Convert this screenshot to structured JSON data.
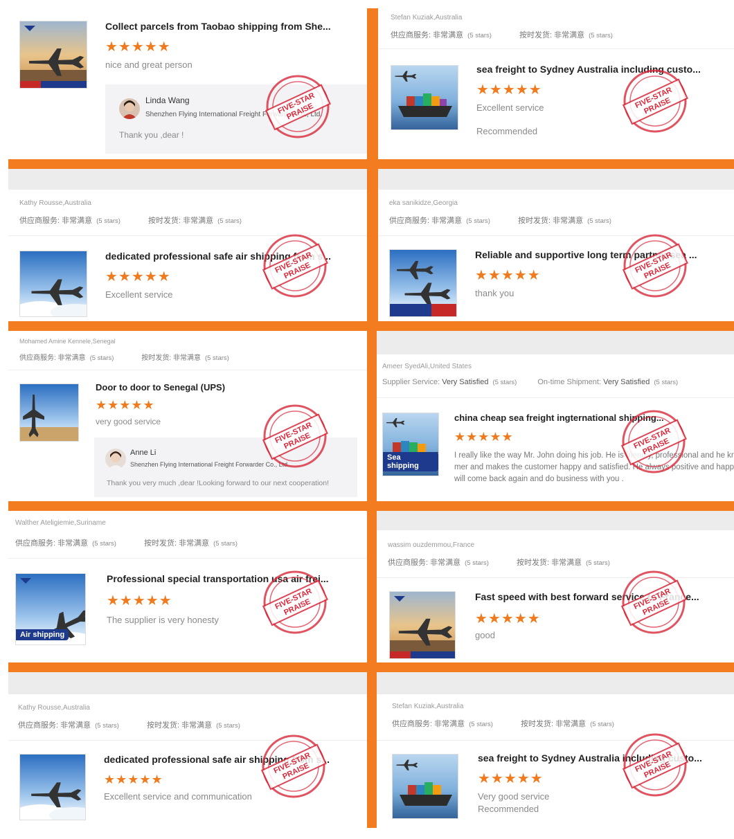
{
  "stamp_text": {
    "line1": "FIVE-STAR",
    "line2": "PRAISE"
  },
  "colors": {
    "accent": "#f37b20",
    "stars": "#f07a1e",
    "stamp": "#d8283a"
  },
  "labels": {
    "supplier_cn": "供应商服务: 非常满意",
    "ontime_cn": "按时发货: 非常满意",
    "stars": "(5 stars)"
  },
  "cards": [
    {
      "title": "Collect parcels from Taobao shipping from She...",
      "stars": "★★★★★",
      "comment": "nice and great person",
      "reply": {
        "name": "Linda Wang",
        "company": "Shenzhen Flying International Freight Forwarder Co., Ltd.",
        "text": "Thank you ,dear !"
      }
    },
    {
      "reviewer": "Stefan Kuziak,Australia",
      "title": "sea freight to Sydney Australia including custo...",
      "stars": "★★★★★",
      "comment": "Excellent service",
      "comment2": "Recommended"
    },
    {
      "reviewer": "Kathy Rousse,Australia",
      "title": "dedicated professional safe air shipping from s...",
      "stars": "★★★★★",
      "comment": "Excellent service"
    },
    {
      "reviewer": "eka sanikidze,Georgia",
      "title": "Reliable and supportive long term partner sea ...",
      "stars": "★★★★★",
      "comment": "thank you"
    },
    {
      "reviewer": "Mohamed Amine Kennele,Senegal",
      "title": "Door to door to Senegal (UPS)",
      "stars": "★★★★★",
      "comment": "very good service",
      "reply": {
        "name": "Anne Li",
        "company": "Shenzhen Flying International Freight Forwarder Co., Ltd.",
        "text": "Thank you very much ,dear !Looking forward to our next cooperation!"
      }
    },
    {
      "reviewer": "Ameer SyedAli,United States",
      "supplier_label": "Supplier Service:",
      "supplier_value": "Very Satisfied",
      "ontime_label": "On-time Shipment:",
      "ontime_value": "Very Satisfied",
      "title": "china cheap sea freight ingternational shipping...",
      "stars": "★★★★★",
      "long_comment": [
        "I really like the way Mr. John doing his job. He is friendly, professional and he knows",
        "mer and makes the customer happy and satisfied. He always positive and happy.",
        "will come back again and do business with you ."
      ],
      "thumb_label": "Sea shipping"
    },
    {
      "reviewer": "Walther Ateligiemie,Suriname",
      "title": "Professional special transportation usa air frei...",
      "stars": "★★★★★",
      "comment": "The supplier is very honesty",
      "thumb_label": "Air shipping"
    },
    {
      "reviewer": "wassim ouzdemmou,France",
      "title": "Fast speed with best forward service to France...",
      "stars": "★★★★★",
      "comment": "good"
    },
    {
      "reviewer": "Kathy Rousse,Australia",
      "title": "dedicated professional safe air shipping from s...",
      "stars": "★★★★★",
      "comment": "Excellent service and communication"
    },
    {
      "reviewer": "Stefan Kuziak,Australia",
      "title": "sea freight to Sydney Australia including custo...",
      "stars": "★★★★★",
      "comment": "Very good service",
      "comment2": "Recommended"
    }
  ]
}
